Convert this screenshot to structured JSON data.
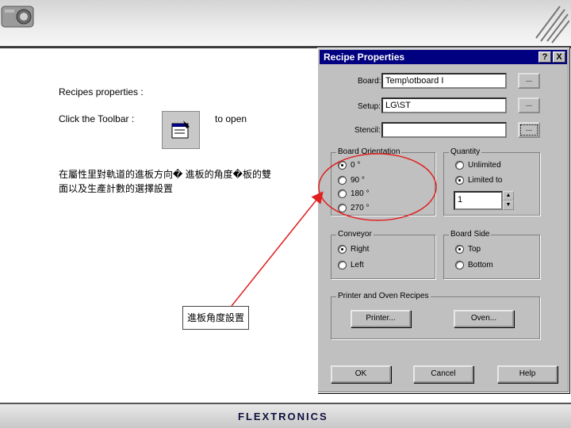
{
  "slide": {
    "intro": "Recipes properties :",
    "instruction_prefix": "Click the Toolbar :",
    "instruction_suffix": "to open",
    "chinese_description": "在屬性里對軌道的進板方向� 進板的角度�板的雙面以及生產計數的選擇設置",
    "callout_label": "進板角度設置",
    "brand": "FLEXTRONICS"
  },
  "dialog": {
    "title": "Recipe Properties",
    "help_btn": "?",
    "close_btn": "X",
    "board_label": "Board:",
    "board_value": "Temp\\otboard I",
    "setup_label": "Setup:",
    "setup_value": "LG\\ST",
    "stencil_label": "Stencil:",
    "stencil_value": "",
    "browse": "...",
    "orientation": {
      "title": "Board Orientation",
      "options": [
        "0 °",
        "90 °",
        "180 °",
        "270 °"
      ],
      "selected": "0 °"
    },
    "quantity": {
      "title": "Quantity",
      "unlimited": "Unlimited",
      "limited": "Limited to",
      "selected": "Limited to",
      "value": "1"
    },
    "conveyor": {
      "title": "Conveyor",
      "right": "Right",
      "left": "Left",
      "selected": "Right"
    },
    "board_side": {
      "title": "Board Side",
      "top": "Top",
      "bottom": "Bottom",
      "selected": "Top"
    },
    "printer_oven": {
      "title": "Printer and Oven Recipes",
      "printer_btn": "Printer...",
      "oven_btn": "Oven..."
    },
    "ok_btn": "OK",
    "cancel_btn": "Cancel",
    "help_text_btn": "Help"
  },
  "colors": {
    "titlebar": "#000080",
    "dialog_bg": "#c0c0c0",
    "annotation": "#e02020"
  },
  "icons": {
    "toolbar_button": "recipe-properties-icon",
    "header_left": "projector-icon"
  }
}
